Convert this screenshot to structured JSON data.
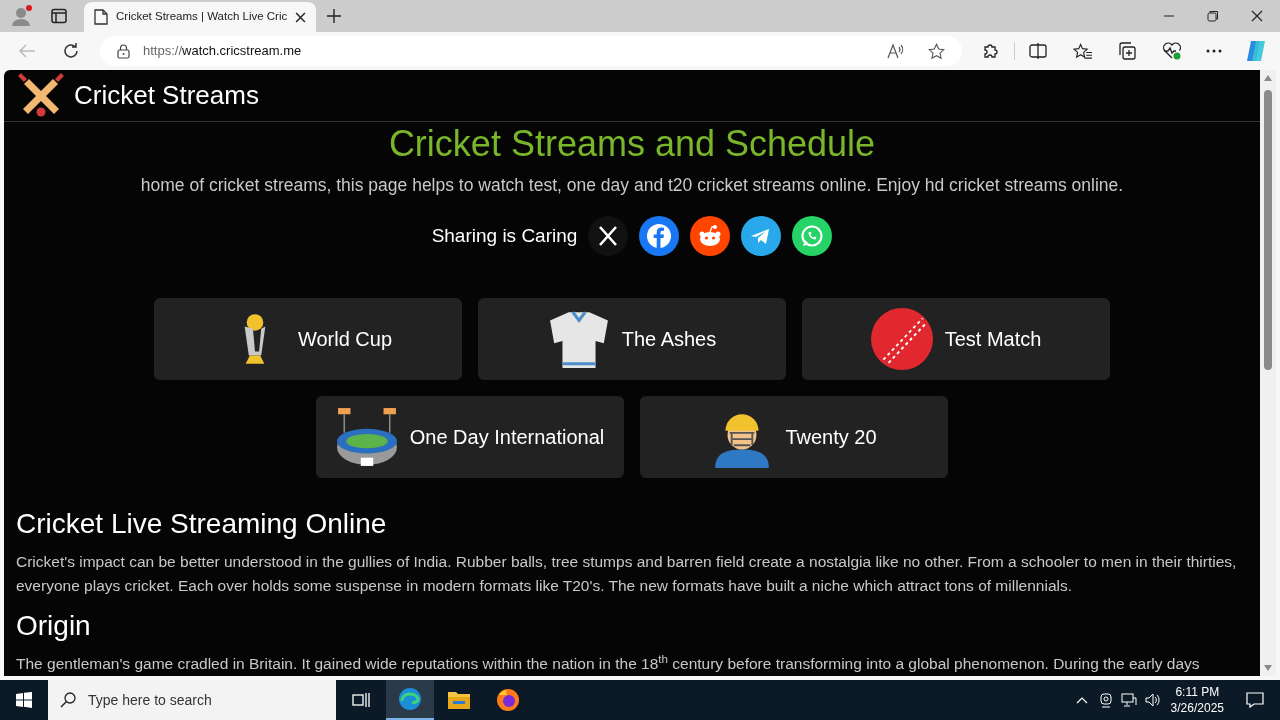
{
  "browser": {
    "tab_title": "Cricket Streams | Watch Live Cric",
    "url_scheme": "https://",
    "url_host": "watch.cricstream.me"
  },
  "page": {
    "site_name": "Cricket Streams",
    "heading": "Cricket Streams and Schedule",
    "subtitle": "home of cricket streams, this page helps to watch test, one day and t20 cricket streams online. Enjoy hd cricket streams online.",
    "share_label": "Sharing is Caring",
    "share_buttons": [
      {
        "kind": "x"
      },
      {
        "kind": "facebook"
      },
      {
        "kind": "reddit"
      },
      {
        "kind": "telegram"
      },
      {
        "kind": "whatsapp"
      }
    ],
    "categories": [
      {
        "kind": "trophy",
        "label": "World Cup"
      },
      {
        "kind": "jersey",
        "label": "The Ashes"
      },
      {
        "kind": "ball",
        "label": "Test Match"
      },
      {
        "kind": "stadium",
        "label": "One Day International"
      },
      {
        "kind": "helmet",
        "label": "Twenty 20"
      }
    ],
    "sections": [
      {
        "heading": "Cricket Live Streaming Online",
        "text": "Cricket's impact can be better understood in the gullies of India. Rubber balls, tree stumps and barren field create a nostalgia like no other. From a schooler to men in their thirties, everyone plays cricket. Each over holds some suspense in modern formats like T20's. The new formats have built a niche which attract tons of millennials."
      },
      {
        "heading": "Origin",
        "text": "The gentleman's game cradled in Britain. It gained wide reputations within the nation in the 18$^{th}$ century before transforming into a global phenomenon. During the early days"
      }
    ]
  },
  "taskbar": {
    "search_placeholder": "Type here to search",
    "time": "6:11 PM",
    "date": "3/26/2025"
  }
}
